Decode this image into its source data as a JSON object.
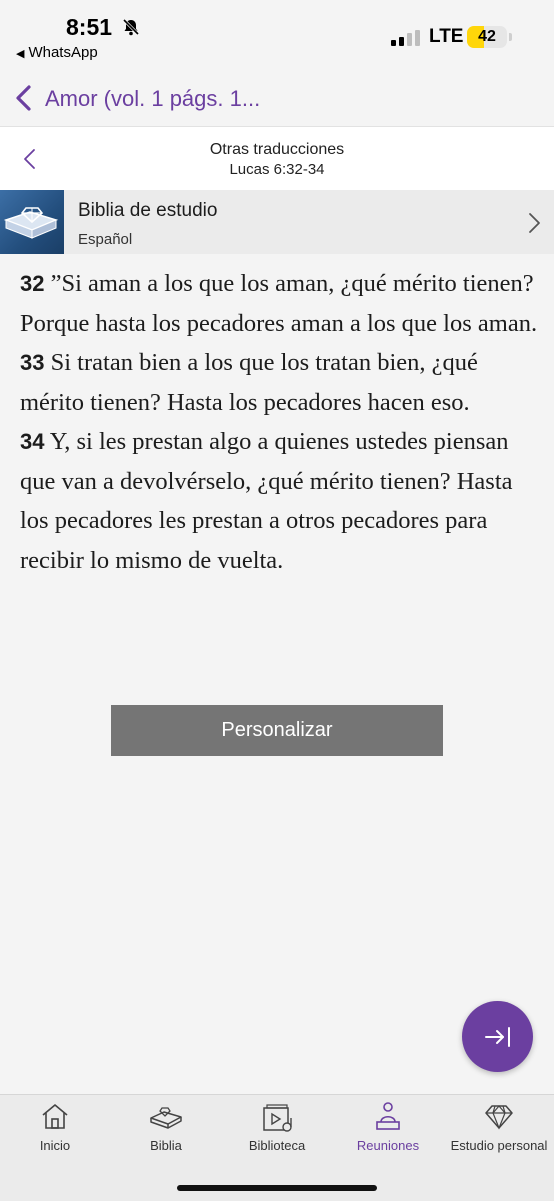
{
  "status_bar": {
    "time": "8:51",
    "back_app": "WhatsApp",
    "network": "LTE",
    "battery": "42",
    "battery_level": 0.42
  },
  "nav": {
    "title": "Amor (vol. 1 págs. 1..."
  },
  "panel": {
    "title": "Otras traducciones",
    "reference": "Lucas 6:32-34"
  },
  "publication": {
    "name": "Biblia de estudio",
    "language": "Español"
  },
  "verses": [
    {
      "num": "32",
      "text": " ”Si aman a los que los aman, ¿qué mérito tienen? Porque hasta los pecadores aman a los que los aman. "
    },
    {
      "num": "33",
      "text": " Si tratan bien a los que los tratan bien, ¿qué mérito tienen? Hasta los pecadores hacen eso. "
    },
    {
      "num": "34",
      "text": " Y, si les prestan algo a quienes ustedes piensan que van a devolvérselo, ¿qué mérito tienen? Hasta los pecadores les prestan a otros pecadores para recibir lo mismo de vuelta."
    }
  ],
  "customize_button": "Personalizar",
  "tabs": [
    {
      "label": "Inicio",
      "icon": "home-icon"
    },
    {
      "label": "Biblia",
      "icon": "bible-icon"
    },
    {
      "label": "Biblioteca",
      "icon": "library-icon"
    },
    {
      "label": "Reuniones",
      "icon": "meetings-icon",
      "active": true
    },
    {
      "label": "Estudio personal",
      "icon": "diamond-icon"
    }
  ],
  "colors": {
    "accent": "#6b3fa0",
    "button": "#757575",
    "battery": "#ffd60a"
  }
}
